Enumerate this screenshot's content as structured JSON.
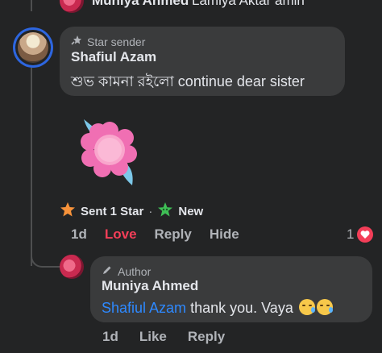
{
  "top_comment": {
    "name": "Muniya Ahmed",
    "text": "Lamiya Aktar amin"
  },
  "comment": {
    "badge": "Star sender",
    "name": "Shafiul Azam",
    "text": "শুভ কামনা রইলো continue dear sister",
    "stars": {
      "sent_label": "Sent 1 Star",
      "separator": "·",
      "new_label": "New"
    },
    "actions": {
      "time": "1d",
      "love": "Love",
      "reply": "Reply",
      "hide": "Hide"
    },
    "reaction_count": "1"
  },
  "reply": {
    "badge": "Author",
    "name": "Muniya Ahmed",
    "mention": "Shafiul Azam",
    "text": "thank you. Vaya",
    "actions": {
      "time": "1d",
      "like": "Like",
      "reply": "Reply"
    }
  },
  "colors": {
    "background": "#232425",
    "bubble": "#3a3b3c",
    "love": "#f33e58",
    "mention": "#2e89ff",
    "avatar_ring": "#2d66e0"
  },
  "icons": [
    "star-sender-icon",
    "pencil-icon",
    "star-icon",
    "sparkle-star-icon",
    "heart-icon",
    "crying-emoji-icon"
  ]
}
